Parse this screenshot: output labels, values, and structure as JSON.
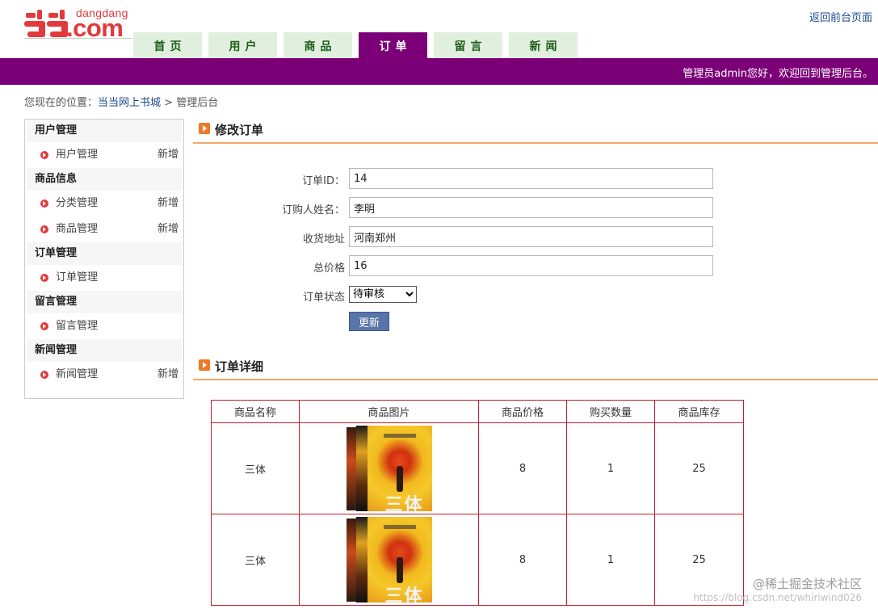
{
  "logo": {
    "small": "dangdang",
    "big": ".com"
  },
  "header": {
    "back_link": "返回前台页面"
  },
  "nav": {
    "tabs": [
      "首页",
      "用户",
      "商品",
      "订单",
      "留言",
      "新闻"
    ],
    "active": "订单"
  },
  "banner": {
    "welcome": "管理员admin您好，欢迎回到管理后台。"
  },
  "breadcrumb": {
    "prefix": "您现在的位置：",
    "home": "当当网上书城",
    "sep": " > ",
    "current": "管理后台"
  },
  "sidebar": {
    "groups": [
      {
        "title": "用户管理",
        "items": [
          {
            "label": "用户管理",
            "add": "新增"
          }
        ]
      },
      {
        "title": "商品信息",
        "items": [
          {
            "label": "分类管理",
            "add": "新增"
          },
          {
            "label": "商品管理",
            "add": "新增"
          }
        ]
      },
      {
        "title": "订单管理",
        "items": [
          {
            "label": "订单管理",
            "add": ""
          }
        ]
      },
      {
        "title": "留言管理",
        "items": [
          {
            "label": "留言管理",
            "add": ""
          }
        ]
      },
      {
        "title": "新闻管理",
        "items": [
          {
            "label": "新闻管理",
            "add": "新增"
          }
        ]
      }
    ]
  },
  "edit_order": {
    "title": "修改订单",
    "fields": [
      {
        "label": "订单ID：",
        "value": "14"
      },
      {
        "label": "订购人姓名：",
        "value": "李明"
      },
      {
        "label": "收货地址",
        "value": "河南郑州"
      },
      {
        "label": "总价格",
        "value": "16"
      }
    ],
    "status_label": "订单状态",
    "status_value": "待审核",
    "update_button": "更新"
  },
  "order_detail": {
    "title": "订单详细",
    "headers": [
      "商品名称",
      "商品图片",
      "商品价格",
      "购买数量",
      "商品库存"
    ],
    "cover_text": "三体",
    "rows": [
      {
        "name": "三体",
        "price": "8",
        "qty": "1",
        "stock": "25"
      },
      {
        "name": "三体",
        "price": "8",
        "qty": "1",
        "stock": "25"
      }
    ]
  },
  "watermark": {
    "line1": "@稀土掘金技术社区",
    "line2": "https://blog.csdn.net/whiriwind026"
  }
}
